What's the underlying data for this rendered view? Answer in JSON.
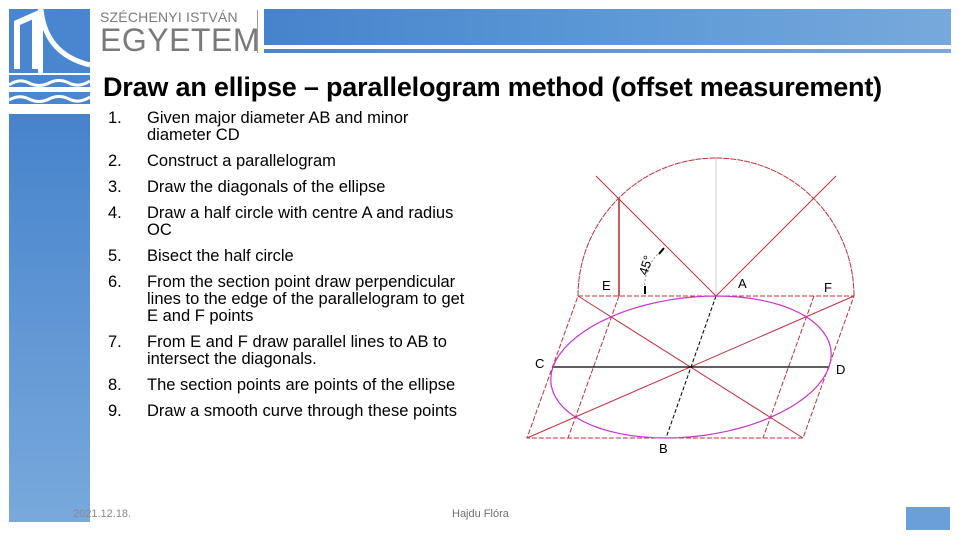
{
  "brand": {
    "line1": "SZÉCHENYI ISTVÁN",
    "line2": "EGYETEM",
    "color": "#4a86cf"
  },
  "title": "Draw an ellipse – parallelogram method (offset measurement)",
  "steps": [
    {
      "num": "1.",
      "text": "Given major diameter AB and minor diameter CD"
    },
    {
      "num": "2.",
      "text": "Construct a parallelogram"
    },
    {
      "num": "3.",
      "text": "Draw the diagonals of the ellipse"
    },
    {
      "num": "4.",
      "text": "Draw a half circle with centre A and radius OC"
    },
    {
      "num": "5.",
      "text": "Bisect the half circle"
    },
    {
      "num": "6.",
      "text": "From the section point draw perpendicular lines to the edge of the parallelogram to get E and F points"
    },
    {
      "num": "7.",
      "text": "From E and F draw parallel lines to AB to intersect the diagonals."
    },
    {
      "num": "8.",
      "text": "The section points are points of the ellipse"
    },
    {
      "num": "9.",
      "text": "Draw a smooth curve through these points"
    }
  ],
  "diagram": {
    "labels": {
      "A": "A",
      "B": "B",
      "C": "C",
      "D": "D",
      "E": "E",
      "F": "F",
      "angle": "45°"
    },
    "colors": {
      "construction": "#c0303a",
      "ellipse": "#cc33cc",
      "axis": "#000000",
      "guide": "#cccccc"
    }
  },
  "footer": {
    "date": "2021.12.18.",
    "author": "Hajdu Flóra"
  }
}
